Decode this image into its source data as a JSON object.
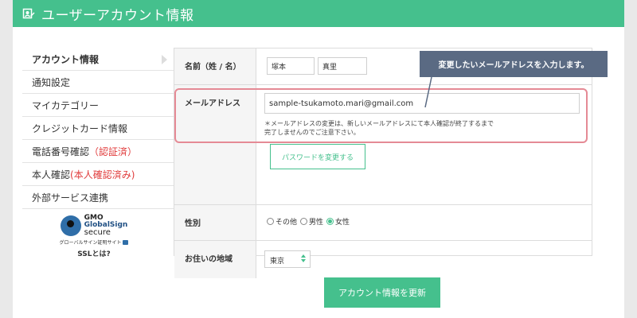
{
  "header": {
    "title": "ユーザーアカウント情報",
    "icon": "profile-edit-icon"
  },
  "sidebar": {
    "items": [
      {
        "label": "アカウント情報"
      },
      {
        "label": "通知設定"
      },
      {
        "label": "マイカテゴリー"
      },
      {
        "label": "クレジットカード情報"
      },
      {
        "label": "電話番号確認",
        "status": "（認証済）"
      },
      {
        "label": "本人確認",
        "status": "(本人確認済み)"
      },
      {
        "label": "外部サービス連携"
      }
    ],
    "ssl": {
      "gmo": "GMO",
      "brand": "GlobalSign",
      "secure": "secure",
      "sub": "グローバルサイン証明サイト",
      "link": "SSLとは?"
    }
  },
  "form": {
    "name": {
      "label": "名前（姓 / 名）",
      "last": "塚本",
      "first": "真里"
    },
    "email": {
      "label": "メールアドレス",
      "value": "sample-tsukamoto.mari@gmail.com",
      "note_line1": "＊メールアドレスの変更は、新しいメールアドレスにて本人確認が終了するまで",
      "note_line2": "完了しませんのでご注意下さい。",
      "password_button": "パスワードを変更する"
    },
    "gender": {
      "label": "性別",
      "options": [
        "その他",
        "男性",
        "女性"
      ],
      "selected": "女性"
    },
    "region": {
      "label": "お住いの地域",
      "value": "東京"
    }
  },
  "tooltip": {
    "text": "変更したいメールアドレスを入力します。"
  },
  "submit": {
    "label": "アカウント情報を更新"
  },
  "colors": {
    "accent": "#45c08d",
    "highlight": "#e58a95",
    "tooltip": "#5a6a83",
    "alert": "#e03a3a"
  }
}
